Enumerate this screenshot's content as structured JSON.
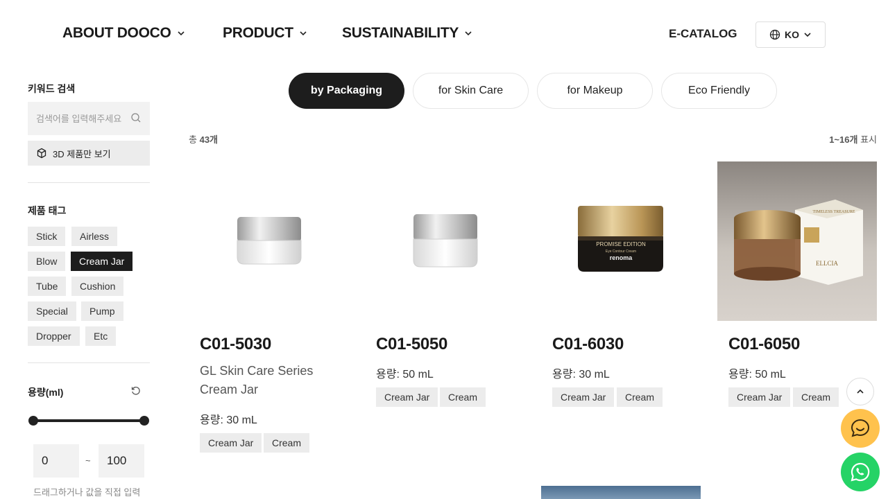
{
  "header": {
    "nav": [
      {
        "label": "ABOUT DOOCO"
      },
      {
        "label": "PRODUCT"
      },
      {
        "label": "SUSTAINABILITY"
      }
    ],
    "ecatalog": "E-CATALOG",
    "language": "KO"
  },
  "sidebar": {
    "keyword_label": "키워드 검색",
    "search_placeholder": "검색어를 입력해주세요",
    "button_3d": "3D 제품만 보기",
    "tags_label": "제품 태그",
    "tags": [
      "Stick",
      "Airless",
      "Blow",
      "Cream Jar",
      "Tube",
      "Cushion",
      "Special",
      "Pump",
      "Dropper",
      "Etc"
    ],
    "active_tag": "Cream Jar",
    "capacity_label": "용량(ml)",
    "range_min": "0",
    "range_max": "100",
    "range_sep": "~",
    "range_hint": "드래그하거나 값을 직접 입력"
  },
  "filters": {
    "pills": [
      "by Packaging",
      "for Skin Care",
      "for Makeup",
      "Eco Friendly"
    ],
    "active": "by Packaging"
  },
  "results": {
    "total_prefix": "총",
    "total": "43개",
    "range": "1~16개",
    "range_suffix": "표시"
  },
  "products": [
    {
      "code": "C01-5030",
      "name": "GL Skin Care Series Cream Jar",
      "capacity": "용량: 30 mL",
      "tags": [
        "Cream Jar",
        "Cream"
      ]
    },
    {
      "code": "C01-5050",
      "name": "",
      "capacity": "용량: 50 mL",
      "tags": [
        "Cream Jar",
        "Cream"
      ]
    },
    {
      "code": "C01-6030",
      "name": "",
      "capacity": "용량: 30 mL",
      "tags": [
        "Cream Jar",
        "Cream"
      ],
      "jar_text": [
        "PROMISE EDITION",
        "Eye Contour Cream",
        "renoma"
      ]
    },
    {
      "code": "C01-6050",
      "name": "",
      "capacity": "용량: 50 mL",
      "tags": [
        "Cream Jar",
        "Cream"
      ],
      "box_text": [
        "TIMELESS TREASURE",
        "ELLCIA"
      ]
    }
  ],
  "colors": {
    "active_dark": "#1d1d1d",
    "tag_bg": "#ececec",
    "chat_yellow": "#ffc24d",
    "whatsapp_green": "#25d366"
  }
}
